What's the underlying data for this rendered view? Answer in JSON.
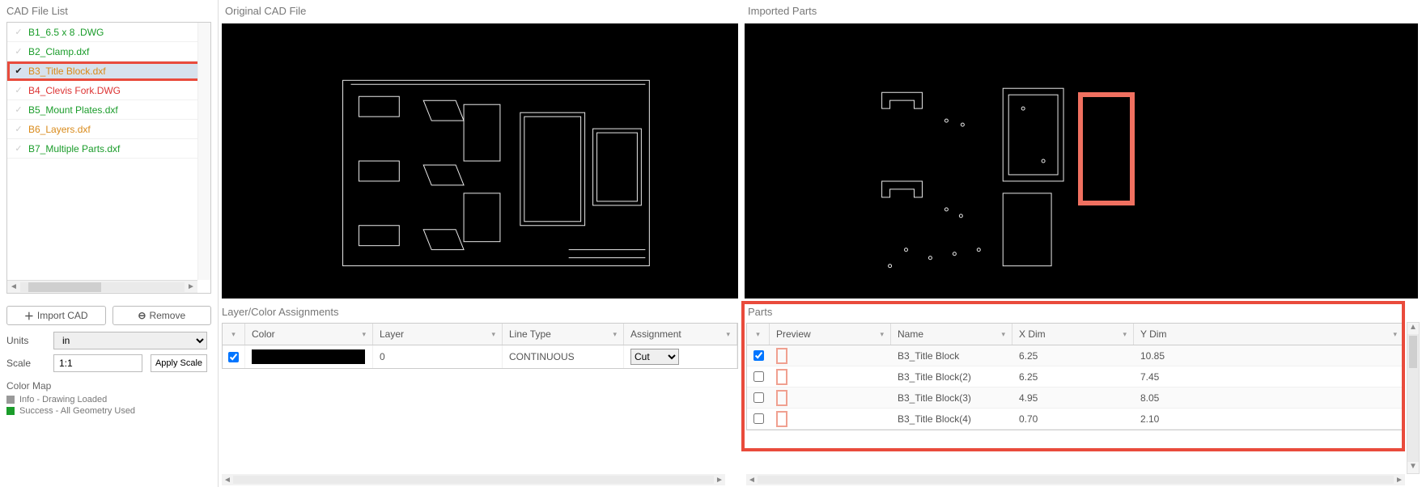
{
  "file_list": {
    "title": "CAD File List",
    "items": [
      {
        "name": "B1_6.5 x 8 .DWG",
        "color": "green",
        "checked": false,
        "selected": false
      },
      {
        "name": "B2_Clamp.dxf",
        "color": "green",
        "checked": false,
        "selected": false
      },
      {
        "name": "B3_Title Block.dxf",
        "color": "orange",
        "checked": true,
        "selected": true,
        "highlighted": true
      },
      {
        "name": "B4_Clevis Fork.DWG",
        "color": "red",
        "checked": false,
        "selected": false
      },
      {
        "name": "B5_Mount Plates.dxf",
        "color": "green",
        "checked": false,
        "selected": false
      },
      {
        "name": "B6_Layers.dxf",
        "color": "orange",
        "checked": false,
        "selected": false
      },
      {
        "name": "B7_Multiple Parts.dxf",
        "color": "green",
        "checked": false,
        "selected": false
      }
    ]
  },
  "center_viewer": {
    "title": "Original CAD File"
  },
  "right_viewer": {
    "title": "Imported Parts"
  },
  "buttons": {
    "import": "Import CAD",
    "remove": "Remove"
  },
  "units": {
    "label": "Units",
    "value": "in"
  },
  "scale": {
    "label": "Scale",
    "value": "1:1",
    "apply": "Apply Scale"
  },
  "color_map": {
    "title": "Color Map",
    "items": [
      {
        "swatch": "#999999",
        "text": "Info - Drawing Loaded"
      },
      {
        "swatch": "#1a9c2a",
        "text": "Success - All Geometry Used"
      }
    ]
  },
  "layer_grid": {
    "title": "Layer/Color Assignments",
    "headers": {
      "color": "Color",
      "layer": "Layer",
      "linetype": "Line Type",
      "assignment": "Assignment"
    },
    "row": {
      "layer": "0",
      "linetype": "CONTINUOUS",
      "assignment": "Cut",
      "checked": true
    }
  },
  "parts_grid": {
    "title": "Parts",
    "headers": {
      "preview": "Preview",
      "name": "Name",
      "xdim": "X Dim",
      "ydim": "Y Dim"
    },
    "rows": [
      {
        "checked": true,
        "name": "B3_Title Block",
        "x": "6.25",
        "y": "10.85"
      },
      {
        "checked": false,
        "name": "B3_Title Block(2)",
        "x": "6.25",
        "y": "7.45"
      },
      {
        "checked": false,
        "name": "B3_Title Block(3)",
        "x": "4.95",
        "y": "8.05"
      },
      {
        "checked": false,
        "name": "B3_Title Block(4)",
        "x": "0.70",
        "y": "2.10"
      }
    ]
  }
}
